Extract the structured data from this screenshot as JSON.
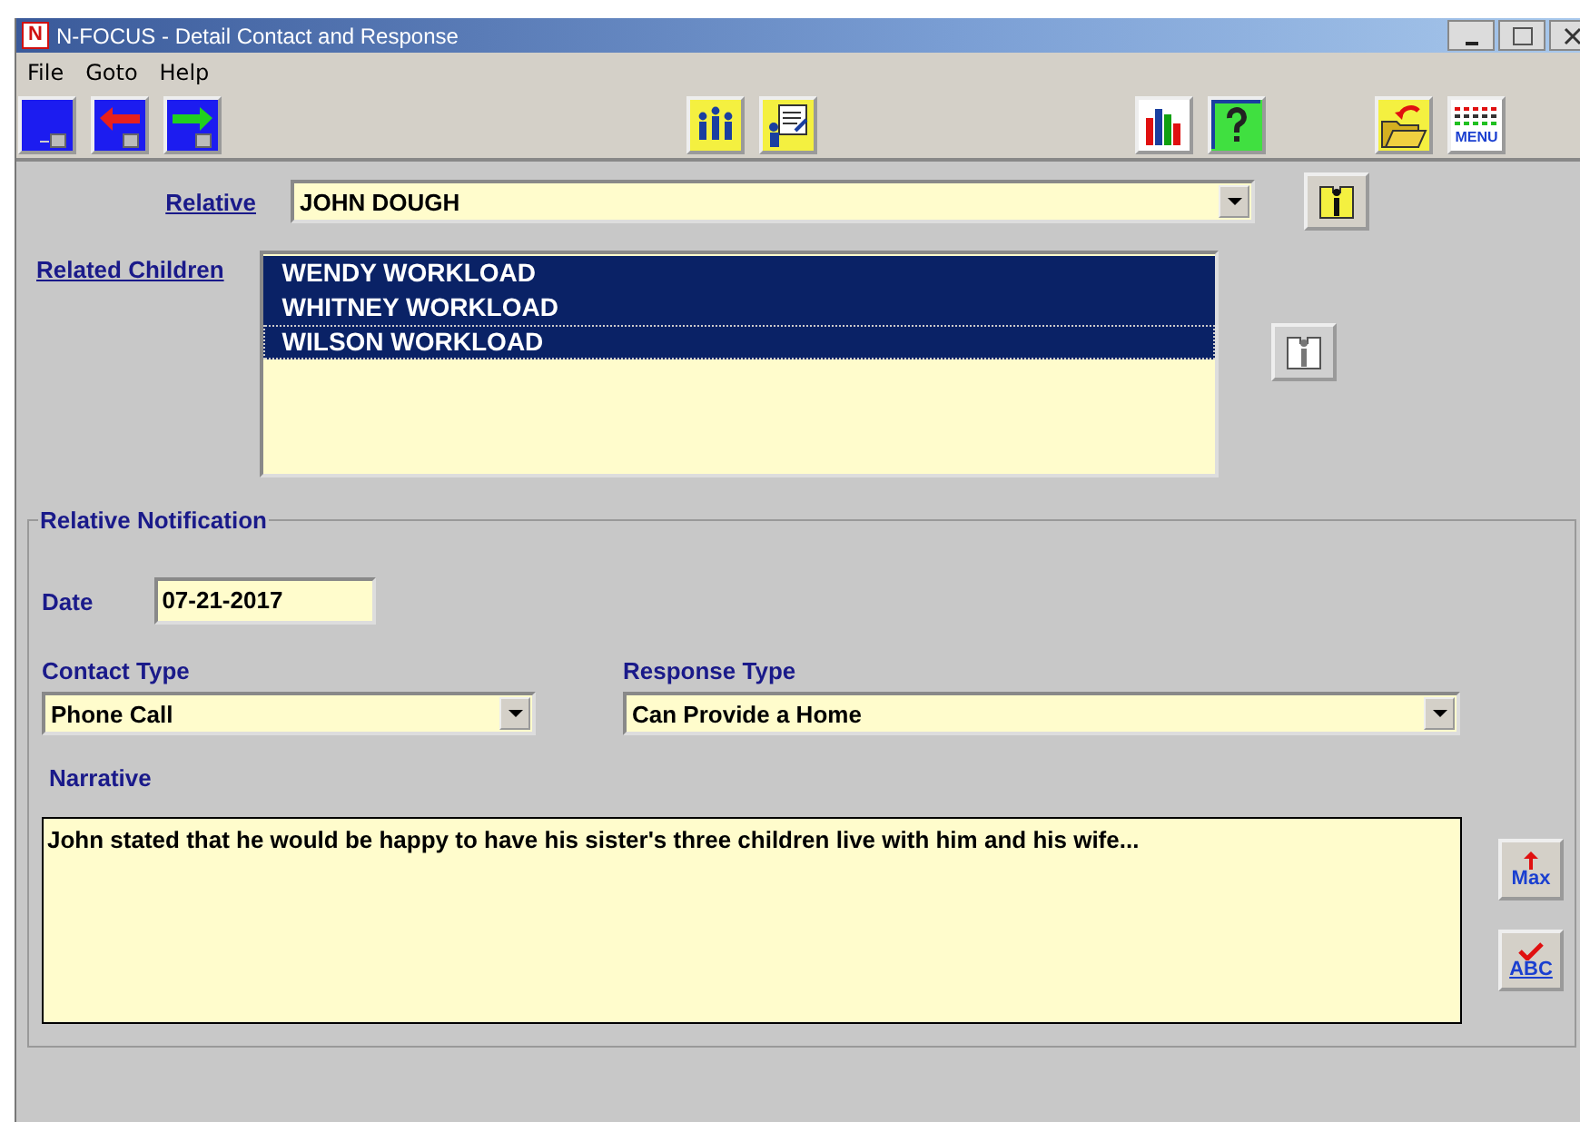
{
  "window": {
    "logo": "N",
    "title": "N-FOCUS - Detail Contact and Response"
  },
  "menu": [
    "File",
    "Goto",
    "Help"
  ],
  "toolbar": [
    [
      {
        "kind": "new"
      },
      {
        "kind": "back"
      },
      {
        "kind": "forward"
      }
    ],
    [
      {
        "kind": "people"
      },
      {
        "kind": "form"
      }
    ],
    [
      {
        "kind": "chart"
      },
      {
        "kind": "help"
      }
    ],
    [
      {
        "kind": "folder"
      },
      {
        "kind": "menu",
        "label": "MENU"
      }
    ]
  ],
  "relative": {
    "label": "Relative",
    "value": "JOHN DOUGH",
    "info_disabled": false
  },
  "related_children": {
    "label": "Related Children",
    "info_disabled": true,
    "items": [
      {
        "name": "WENDY WORKLOAD",
        "selected": true,
        "focused": false
      },
      {
        "name": "WHITNEY WORKLOAD",
        "selected": true,
        "focused": false
      },
      {
        "name": "WILSON WORKLOAD",
        "selected": true,
        "focused": true
      }
    ]
  },
  "notification": {
    "title": "Relative Notification",
    "date": {
      "label": "Date",
      "value": "07-21-2017"
    },
    "contact_type": {
      "label": "Contact Type",
      "value": "Phone Call"
    },
    "response_type": {
      "label": "Response Type",
      "value": "Can Provide a Home"
    },
    "narrative": {
      "label": "Narrative",
      "value": "John stated that he would be happy to have his sister's three children live with him and his wife..."
    },
    "side_buttons": [
      {
        "kind": "max",
        "label": "Max"
      },
      {
        "kind": "spell",
        "label": "ABC"
      }
    ]
  }
}
